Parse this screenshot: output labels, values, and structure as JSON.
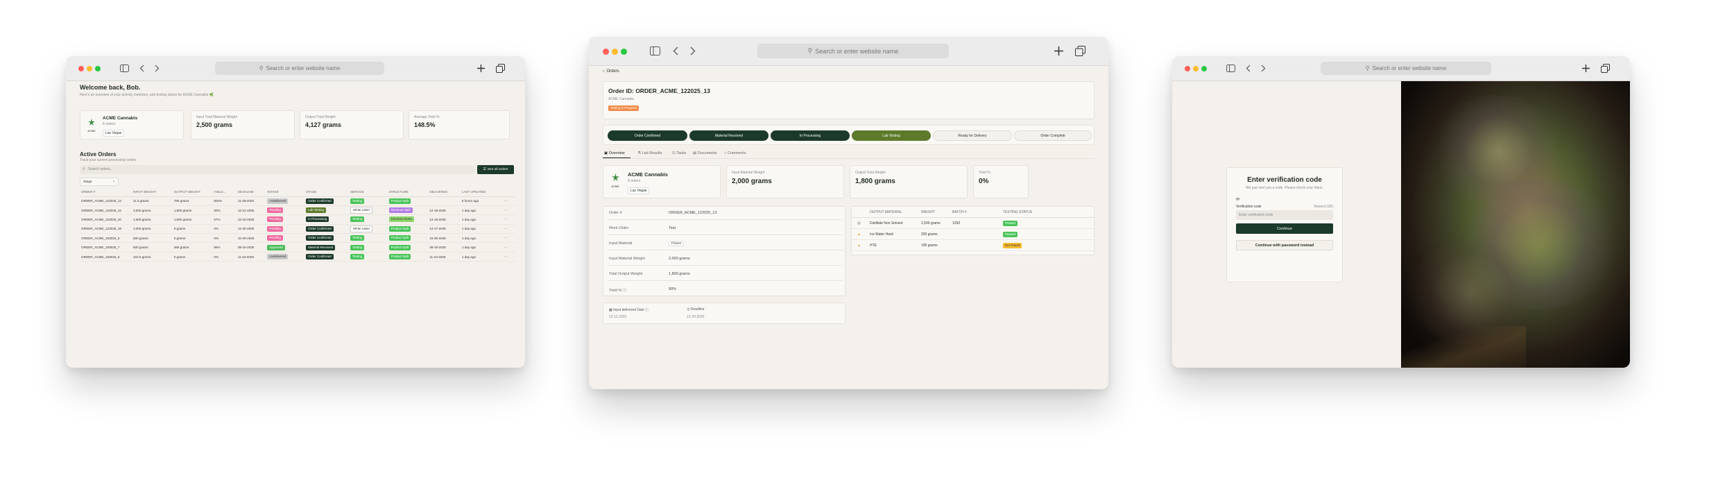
{
  "browser": {
    "url_placeholder": "Search or enter website name"
  },
  "colors": {
    "dark_green": "#1c3a2a",
    "olive": "#5d7a2a",
    "background": "#f4f0eb",
    "traffic_red": "#ff5f57",
    "traffic_yellow": "#febc2e",
    "traffic_green": "#28c840"
  },
  "dashboard": {
    "welcome": "Welcome back, Bob.",
    "subtitle": "Here's an overview of your activity, inventory, and testing status for ACME Cannabis 🌿",
    "org": {
      "name": "ACME Cannabis",
      "orders": "8 orders",
      "location": "Las Vegas",
      "logo_text": "ACME"
    },
    "stats": [
      {
        "label": "Input Total Material Weight",
        "value": "2,500 grams"
      },
      {
        "label": "Output Total Weight",
        "value": "4,127 grams"
      },
      {
        "label": "Average Yield %",
        "value": "148.5%"
      }
    ],
    "active_orders_title": "Active Orders",
    "active_orders_subtitle": "Track your current processing orders",
    "search_placeholder": "Search orders...",
    "see_all": "See all orders",
    "filter": "Stage",
    "columns": [
      "ORDER #",
      "INPUT WEIGHT",
      "OUTPUT WEIGHT",
      "YIELD...",
      "DEADLINE",
      "INTAKE",
      "STAGE",
      "SERVICE",
      "STRUCTURE",
      "DELIVERED",
      "LAST UPDATED"
    ],
    "rows": [
      {
        "order": "ORDER_ACME_122025_13",
        "input": "11.5 grams",
        "output": "790 grams",
        "yield": "802%",
        "deadline": "11-28-2025",
        "intake": "Undelivered",
        "stage": "Order Confirmed",
        "service": "Testing",
        "structure": "Product Split",
        "delivered": "",
        "updated": "6 hours ago"
      },
      {
        "order": "ORDER_ACME_122025_12",
        "input": "2,000 grams",
        "output": "1,800 grams",
        "yield": "90%",
        "deadline": "12-21-2025",
        "intake": "Pending",
        "stage": "Lab Testing",
        "service": "White Label",
        "structure": "Revenue Split",
        "delivered": "12-19-2025",
        "updated": "1 day ago"
      },
      {
        "order": "ORDER_ACME_122025_20",
        "input": "1,000 grams",
        "output": "1,600 grams",
        "yield": "67%",
        "deadline": "12-22-2025",
        "intake": "Pending",
        "stage": "In Processing",
        "service": "Testing",
        "structure": "Structure None",
        "delivered": "12-19-2025",
        "updated": "1 day ago"
      },
      {
        "order": "ORDER_ACME_122025_18",
        "input": "2,000 grams",
        "output": "0 grams",
        "yield": "0%",
        "deadline": "12-30-2025",
        "intake": "Pending",
        "stage": "Order Confirmed",
        "service": "White Label",
        "structure": "Product Split",
        "delivered": "12-17-2025",
        "updated": "1 day ago"
      },
      {
        "order": "ORDER_ACME_100025_6",
        "input": "500 grams",
        "output": "0 grams",
        "yield": "0%",
        "deadline": "10-30-2025",
        "intake": "Pending",
        "stage": "Order Confirmed",
        "service": "Testing",
        "structure": "Product Split",
        "delivered": "10-30-2025",
        "updated": "1 day ago"
      },
      {
        "order": "ORDER_ACME_100025_7",
        "input": "500 grams",
        "output": "480 grams",
        "yield": "96%",
        "deadline": "09-16-2025",
        "intake": "Approved",
        "stage": "Material Received",
        "service": "Testing",
        "structure": "Product Split",
        "delivered": "09-15-2025",
        "updated": "1 day ago"
      },
      {
        "order": "ORDER_ACME_100025_8",
        "input": "102.5 grams",
        "output": "0 grams",
        "yield": "0%",
        "deadline": "11-10-2025",
        "intake": "Undelivered",
        "stage": "Order Confirmed",
        "service": "Testing",
        "structure": "Product Split",
        "delivered": "11-10-2025",
        "updated": "1 day ago"
      }
    ]
  },
  "order_detail": {
    "back_label": "Orders",
    "order_id": "Order ID: ORDER_ACME_122025_13",
    "company": "ACME Cannabis",
    "status_badge": "Testing in Progress",
    "steps": [
      "Order Confirmed",
      "Material Received",
      "In Processing",
      "Lab Testing",
      "Ready for Delivery",
      "Order Complete"
    ],
    "tabs": [
      "Overview",
      "Lab Results",
      "Tasks",
      "Documents",
      "Comments"
    ],
    "org": {
      "name": "ACME Cannabis",
      "orders": "8 orders",
      "location": "Las Vegas",
      "logo_text": "ACME"
    },
    "stats": [
      {
        "label": "Input Material Weight",
        "value": "2,000 grams"
      },
      {
        "label": "Output Total Weight",
        "value": "1,800 grams"
      },
      {
        "label": "Yield %",
        "value": "0%"
      }
    ],
    "details": [
      {
        "label": "Order #",
        "value": "ORDER_ACME_122025_13"
      },
      {
        "label": "Work Order",
        "value": "Test"
      },
      {
        "label": "Input Material",
        "value": "Flower"
      },
      {
        "label": "Input Material Weight",
        "value": "2,000 grams"
      },
      {
        "label": "Total Output Weight",
        "value": "1,800 grams"
      },
      {
        "label": "Yield % ⓘ",
        "value": "90%"
      }
    ],
    "dates": [
      {
        "label": "Input delivered Date ⓘ",
        "value": "12-11-2025"
      },
      {
        "label": "Deadline",
        "value": "12-29-2025"
      }
    ],
    "output_columns": [
      "OUTPUT MATERIAL",
      "WEIGHT",
      "BATCH #",
      "TESTING STATUS"
    ],
    "outputs": [
      {
        "material": "Distillate Non Solvent",
        "weight": "1,500 grams",
        "batch": "1250",
        "status": "Passed"
      },
      {
        "material": "Ice Water Hash",
        "weight": "200 grams",
        "batch": "",
        "status": "Passed"
      },
      {
        "material": "HTE",
        "weight": "100 grams",
        "batch": "",
        "status": "Not Tested"
      }
    ]
  },
  "verify": {
    "title": "Enter verification code",
    "subtitle": "We just sent you a code. Please check your inbox.",
    "field_label": "Verification code",
    "resend": "Resend (30)",
    "placeholder": "Enter verification code",
    "continue": "Continue",
    "alt": "Continue with password instead"
  }
}
